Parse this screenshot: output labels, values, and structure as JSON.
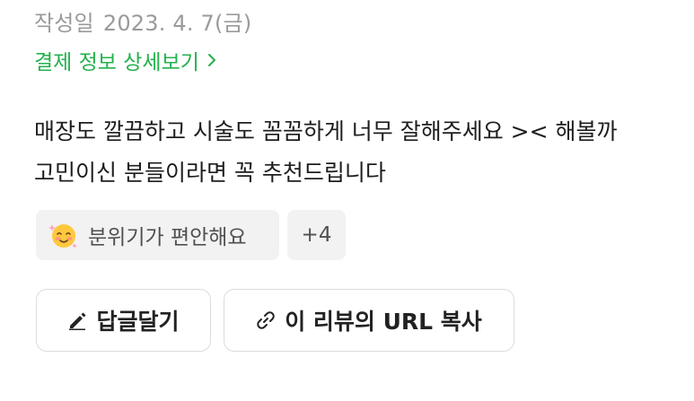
{
  "review": {
    "date_label": "작성일",
    "date_value": "2023. 4. 7(금)",
    "payment_link_label": "결제 정보 상세보기",
    "body_line1": "매장도 깔끔하고 시술도 꼼꼼하게 너무 잘해주세요 >< 해볼까",
    "body_line2": "고민이신 분들이라면 꼭 추천드립니다"
  },
  "tags": {
    "mood_label": "분위기가 편안해요",
    "more_label": "+4"
  },
  "actions": {
    "reply_label": "답글달기",
    "copy_url_label": "이 리뷰의 URL 복사"
  },
  "colors": {
    "link_green": "#23b14d",
    "muted_text": "#9a9a9a",
    "chip_bg": "#f2f2f2"
  },
  "icons": {
    "link_chevron": "chevron-right-icon",
    "mood_emoji": "smiling-face-icon",
    "reply": "pencil-icon",
    "copy": "link-icon"
  }
}
